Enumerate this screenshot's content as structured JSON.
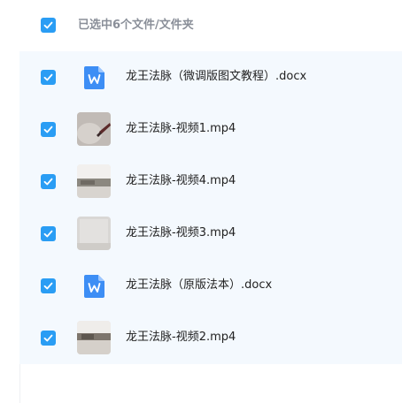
{
  "header": {
    "selection_text": "已选中6个文件/文件夹"
  },
  "files": [
    {
      "name": "龙王法脉（微调版图文教程）.docx",
      "icon": "word-doc-icon",
      "type": "doc"
    },
    {
      "name": "龙王法脉-视频1.mp4",
      "icon": "video-thumbnail",
      "type": "video"
    },
    {
      "name": "龙王法脉-视频4.mp4",
      "icon": "video-thumbnail",
      "type": "video"
    },
    {
      "name": "龙王法脉-视频3.mp4",
      "icon": "video-thumbnail",
      "type": "video"
    },
    {
      "name": "龙王法脉（原版法本）.docx",
      "icon": "word-doc-icon",
      "type": "doc"
    },
    {
      "name": "龙王法脉-视频2.mp4",
      "icon": "video-thumbnail",
      "type": "video"
    }
  ],
  "colors": {
    "accent": "#2a9df4",
    "list_bg": "#f4f9fe",
    "word_icon": "#3d8ef5"
  }
}
